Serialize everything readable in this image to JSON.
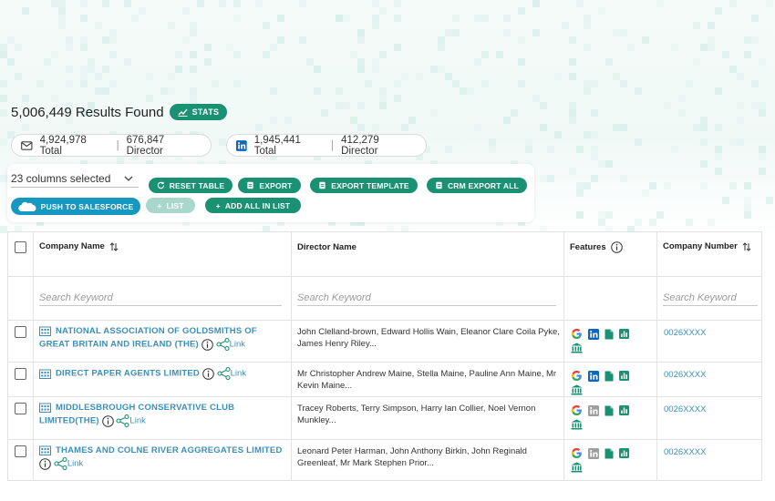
{
  "summary": {
    "results_text": "5,006,449 Results Found",
    "stats_label": "STATS",
    "email_total": "4,924,978 Total",
    "email_director": "676,847 Director",
    "linkedin_total": "1,945,441 Total",
    "linkedin_director": "412,279 Director",
    "separator": "|"
  },
  "toolbar": {
    "columns_selected": "23 columns selected",
    "reset_table": "RESET TABLE",
    "export": "EXPORT",
    "export_template": "EXPORT TEMPLATE",
    "crm_export_all": "CRM EXPORT ALL",
    "push_salesforce": "PUSH TO SALESFORCE",
    "list": "LIST",
    "add_all_in_list": "ADD ALL IN LIST"
  },
  "table": {
    "headers": {
      "company_name": "Company Name",
      "director_name": "Director Name",
      "features": "Features",
      "company_number": "Company Number"
    },
    "search_placeholder": "Search Keyword",
    "link_label": "Link",
    "rows": [
      {
        "company": "NATIONAL ASSOCIATION OF GOLDSMITHS OF GREAT BRITAIN AND IRELAND (THE)",
        "directors": "John Clelland-brown, Edward Hollis Wain, Eleanor Clare Coila Pyke, James Henry Riley...",
        "number": "0026XXXX",
        "linkedin_active": true
      },
      {
        "company": "DIRECT PAPER AGENTS LIMITED",
        "directors": "Mr Christopher Andrew Maine, Stella Maine, Pauline Ann Maine, Mr Kevin Maine...",
        "number": "0026XXXX",
        "linkedin_active": true
      },
      {
        "company": "MIDDLESBROUGH CONSERVATIVE CLUB LIMITED(THE)",
        "directors": "Tracey Roberts, Terry Simpson, Harry Ian Collier, Noel Vernon Munkley...",
        "number": "0026XXXX",
        "linkedin_active": false
      },
      {
        "company": "THAMES AND COLNE RIVER AGGREGATES LIMITED",
        "directors": "Leonard Peter Harman, John Anthony Birkin, John Reginald Greenleaf, Mr Mark Stephen Prior...",
        "number": "0026XXXX",
        "linkedin_active": false
      }
    ]
  },
  "colors": {
    "accent": "#1b9173",
    "link": "#3c8fb8",
    "salesforce": "#1798c1",
    "linkedin": "#0a66c2"
  },
  "icons": [
    "stats-chart-icon",
    "email-icon",
    "linkedin-icon",
    "chevron-down-icon",
    "reset-icon",
    "export-icon",
    "plus-icon",
    "salesforce-icon",
    "sort-icon",
    "info-icon",
    "share-icon",
    "building-icon",
    "google-icon",
    "document-icon",
    "chart-icon",
    "bank-icon"
  ]
}
